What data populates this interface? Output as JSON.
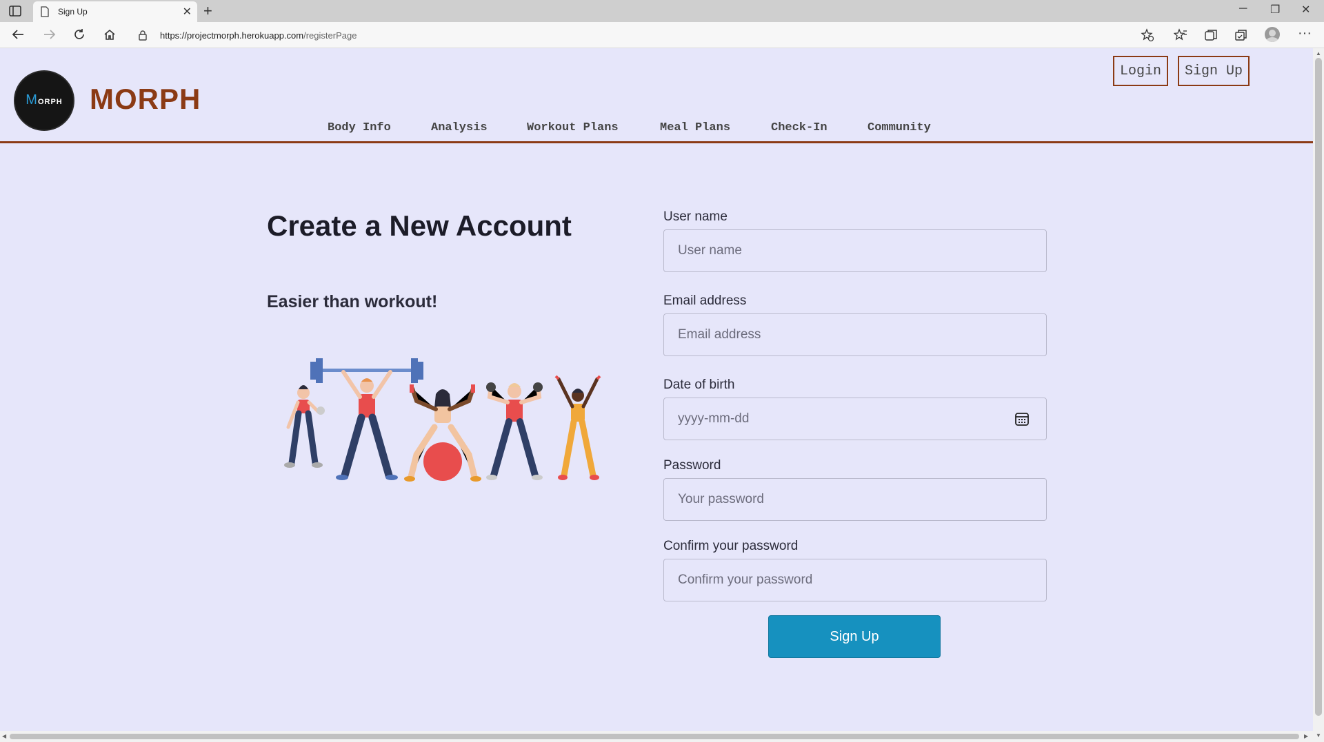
{
  "browser": {
    "tab_title": "Sign Up",
    "url_host": "https://projectmorph.herokuapp.com",
    "url_path": "/registerPage"
  },
  "header": {
    "logo_text_m": "M",
    "logo_text_rest": "ORPH",
    "brand": "MORPH",
    "login_label": "Login",
    "signup_label": "Sign Up",
    "nav": [
      "Body Info",
      "Analysis",
      "Workout Plans",
      "Meal Plans",
      "Check-In",
      "Community"
    ]
  },
  "main": {
    "title": "Create a New Account",
    "subtitle": "Easier than workout!"
  },
  "form": {
    "username_label": "User name",
    "username_placeholder": "User name",
    "email_label": "Email address",
    "email_placeholder": "Email address",
    "dob_label": "Date of birth",
    "dob_placeholder": "yyyy-mm-dd",
    "password_label": "Password",
    "password_placeholder": "Your password",
    "confirm_label": "Confirm your password",
    "confirm_placeholder": "Confirm your password",
    "submit_label": "Sign Up"
  },
  "colors": {
    "page_bg": "#e6e6fa",
    "brand": "#8b3a14",
    "button": "#1691bf"
  }
}
